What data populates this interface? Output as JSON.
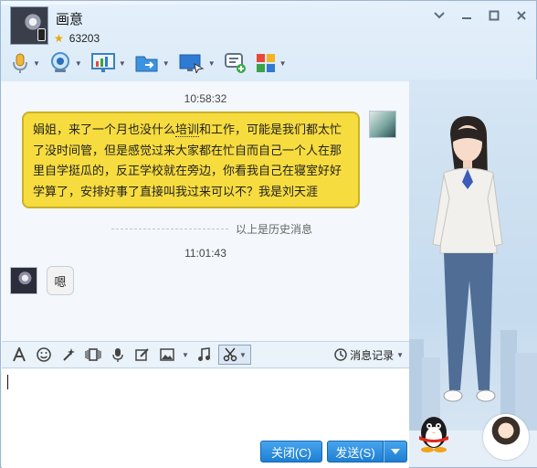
{
  "window": {
    "title": "画意",
    "level_number": "63203",
    "buttons": {
      "minimize_icon": "chevron-down-icon",
      "restore_icon": "minimize-icon",
      "maximize_icon": "maximize-icon",
      "close_icon": "close-icon"
    }
  },
  "toolbar": {
    "items": [
      {
        "name": "voice-call",
        "icon": "microphone-icon"
      },
      {
        "name": "video-call",
        "icon": "webcam-icon"
      },
      {
        "name": "remote-desktop",
        "icon": "presentation-icon"
      },
      {
        "name": "send-file",
        "icon": "folder-icon"
      },
      {
        "name": "screen-share",
        "icon": "monitor-icon"
      },
      {
        "name": "add-contact",
        "icon": "chat-plus-icon"
      },
      {
        "name": "app-center",
        "icon": "apps-grid-icon"
      }
    ]
  },
  "chat": {
    "messages": [
      {
        "time": "10:58:32",
        "side": "right",
        "text_before": "娟姐，来了一个月也没什么",
        "text_underlined": "培训",
        "text_after": "和工作，可能是我们都太忙了没时间管，但是感觉过来大家都在忙自而自己一个人在那里自学挺瓜的，反正学校就在旁边，你看我自己在寝室好好学算了，安排好事了直接叫我过来可以不？我是刘天涯"
      },
      {
        "time": "11:01:43",
        "side": "left",
        "text": "嗯"
      }
    ],
    "history_divider": "以上是历史消息"
  },
  "input_toolbar": {
    "history_label": "消息记录"
  },
  "footer": {
    "close_label": "关闭(C)",
    "send_label": "发送(S)"
  }
}
